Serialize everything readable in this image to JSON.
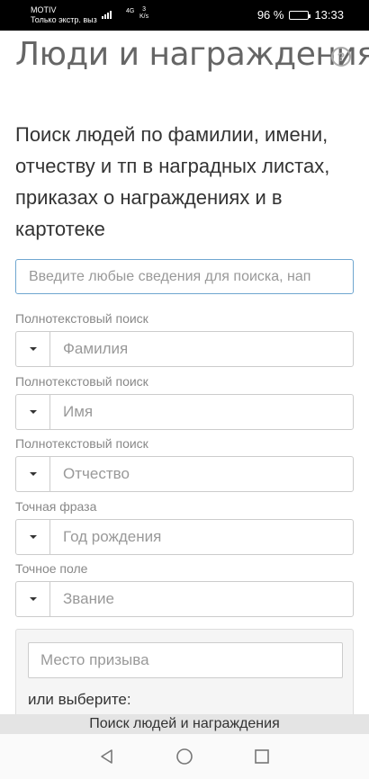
{
  "status_bar": {
    "carrier": "MOTIV",
    "carrier_note": "Только экстр. выз",
    "network_type": "4G",
    "speed_value": "3",
    "speed_unit": "K/s",
    "battery": "96 %",
    "battery_level": 0.96,
    "time": "13:33"
  },
  "page": {
    "title": "Люди и награждения",
    "help_icon": "?",
    "subtitle": "Поиск людей по фамилии, имени, отчеству и тп в наградных листах, приказах о награждениях и в картотеке"
  },
  "search": {
    "placeholder": "Введите любые сведения для поиска, нап"
  },
  "fields": [
    {
      "label": "Полнотекстовый поиск",
      "placeholder": "Фамилия"
    },
    {
      "label": "Полнотекстовый поиск",
      "placeholder": "Имя"
    },
    {
      "label": "Полнотекстовый поиск",
      "placeholder": "Отчество"
    },
    {
      "label": "Точная фраза",
      "placeholder": "Год рождения"
    },
    {
      "label": "Точное поле",
      "placeholder": "Звание"
    }
  ],
  "place_box": {
    "placeholder": "Место призыва",
    "or_text": "или выберите:"
  },
  "bottom_banner": "Поиск людей и награждения",
  "nav": {
    "icons": [
      "back-icon",
      "home-icon",
      "recents-icon"
    ]
  }
}
